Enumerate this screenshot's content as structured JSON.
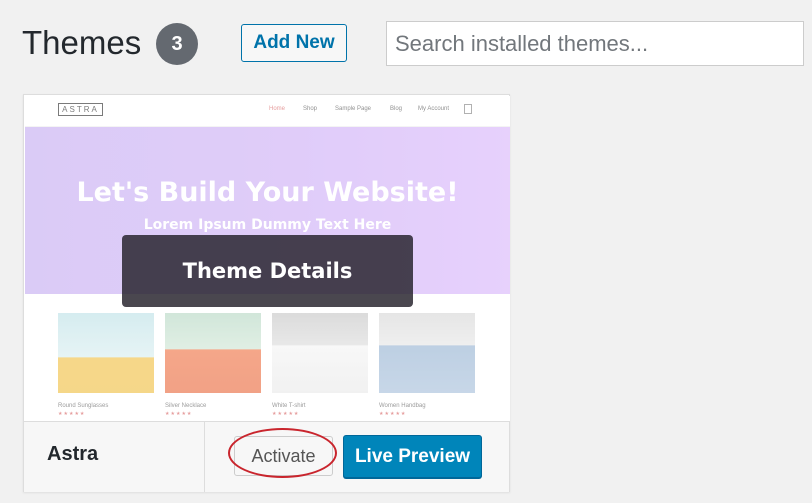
{
  "header": {
    "title": "Themes",
    "count": "3",
    "add_new_label": "Add New",
    "search_placeholder": "Search installed themes..."
  },
  "theme_card": {
    "name": "Astra",
    "details_label": "Theme Details",
    "activate_label": "Activate",
    "live_preview_label": "Live Preview",
    "screenshot": {
      "logo": "ASTRA",
      "menu": [
        "Home",
        "Shop",
        "Sample Page",
        "Blog",
        "My Account"
      ],
      "hero_title": "Let's Build Your Website!",
      "hero_subtitle": "Lorem Ipsum Dummy Text Here",
      "products": [
        {
          "name": "Round Sunglasses",
          "stars": "★★★★★"
        },
        {
          "name": "Silver Necklace",
          "stars": "★★★★★"
        },
        {
          "name": "White T-shirt",
          "stars": "★★★★★"
        },
        {
          "name": "Women Handbag",
          "stars": "★★★★★"
        }
      ]
    }
  },
  "colors": {
    "accent_blue": "#0085ba",
    "link_blue": "#0073aa",
    "annotation_red": "#c9252d",
    "hero_purple": "#cfb1f6"
  }
}
